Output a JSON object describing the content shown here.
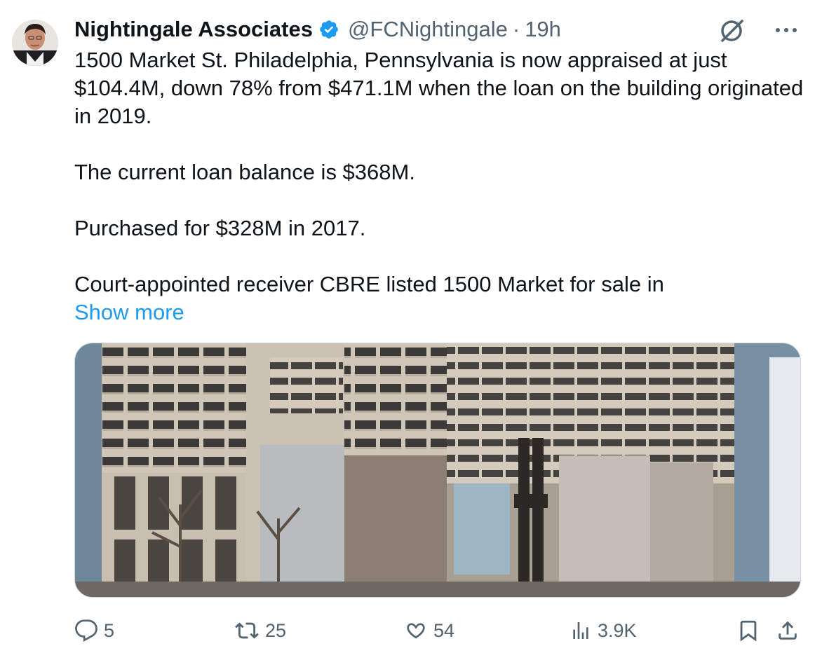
{
  "author": {
    "name": "Nightingale Associates",
    "handle": "@FCNightingale",
    "separator": "·",
    "time": "19h",
    "verified": true
  },
  "icons": {
    "avatar": "avatar",
    "verified": "verified-badge-icon",
    "grok": "grok-icon",
    "more": "more-icon",
    "reply": "reply-icon",
    "retweet": "retweet-icon",
    "like": "like-icon",
    "views": "views-icon",
    "bookmark": "bookmark-icon",
    "share": "share-icon"
  },
  "body": {
    "lines": [
      "1500 Market St. Philadelphia, Pennsylvania is now appraised at just",
      "$104.4M, down 78% from $471.1M when the loan on the building originated",
      "in 2019.",
      "The current loan balance is $368M.",
      "Purchased for $328M in 2017.",
      "Court-appointed receiver CBRE listed 1500 Market for sale in"
    ],
    "show_more": "Show more"
  },
  "metrics": {
    "replies": "5",
    "retweets": "25",
    "likes": "54",
    "views": "3.9K"
  },
  "colors": {
    "text": "#0f1419",
    "secondary": "#536471",
    "link": "#1d9bf0",
    "verified": "#1d9bf0"
  }
}
